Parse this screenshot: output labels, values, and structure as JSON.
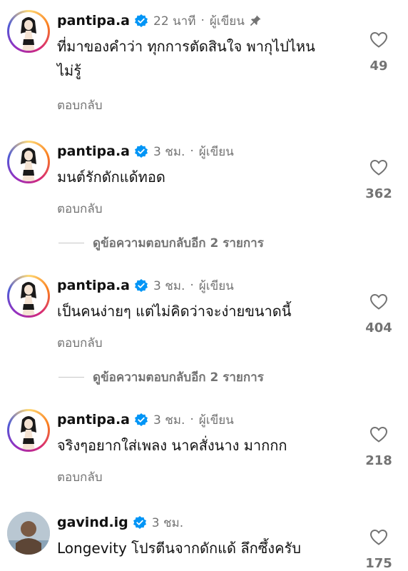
{
  "comments": [
    {
      "username": "pantipa.a",
      "time": "22 นาที",
      "role": "ผู้เขียน",
      "pinned": true,
      "text": "ที่มาของคำว่า ทุกการตัดสินใจ พากุไปไหน ไม่รู้",
      "reply_label": "ตอบกลับ",
      "likes": "49",
      "avatar": "drawn-woman-avatar"
    },
    {
      "username": "pantipa.a",
      "time": "3 ชม.",
      "role": "ผู้เขียน",
      "pinned": false,
      "text": "มนต์รักดักแด้ทอด",
      "reply_label": "ตอบกลับ",
      "likes": "362",
      "view_replies": "ดูข้อความตอบกลับอีก 2 รายการ",
      "avatar": "drawn-woman-avatar"
    },
    {
      "username": "pantipa.a",
      "time": "3 ชม.",
      "role": "ผู้เขียน",
      "pinned": false,
      "text": "เป็นคนง่ายๆ แต่ไม่คิดว่าจะง่ายขนาดนี้",
      "reply_label": "ตอบกลับ",
      "likes": "404",
      "view_replies": "ดูข้อความตอบกลับอีก 2 รายการ",
      "avatar": "drawn-woman-avatar"
    },
    {
      "username": "pantipa.a",
      "time": "3 ชม.",
      "role": "ผู้เขียน",
      "pinned": false,
      "text": "จริงๆอยากใส่เพลง นาคสั่งนาง มากกก",
      "reply_label": "ตอบกลับ",
      "likes": "218",
      "avatar": "drawn-woman-avatar"
    },
    {
      "username": "gavind.ig",
      "time": "3 ชม.",
      "role": "",
      "pinned": false,
      "text": "Longevity โปรตีนจากดักแด้ ลึกซึ้งครับ",
      "likes": "175",
      "avatar": "photo-avatar"
    }
  ],
  "colors": {
    "text": "#111111",
    "secondary": "#737373",
    "verified": "#0095f6"
  },
  "icons": {
    "verified": "verified-badge-icon",
    "pin": "pin-icon",
    "like": "heart-icon"
  }
}
